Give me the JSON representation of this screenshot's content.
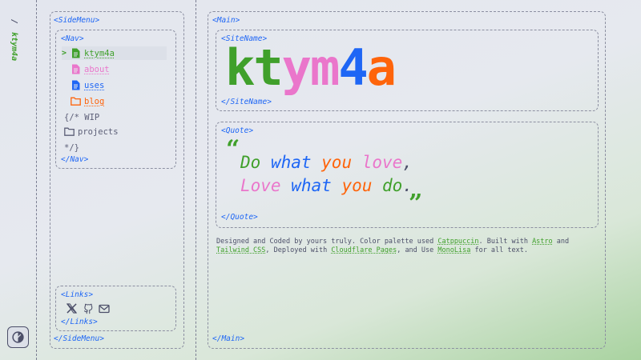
{
  "rail": {
    "separator": "/",
    "site": "ktym4a"
  },
  "tags": {
    "side_menu_open": "<SideMenu>",
    "side_menu_close": "</SideMenu>",
    "nav_open": "<Nav>",
    "nav_close": "</Nav>",
    "links_open": "<Links>",
    "links_close": "</Links>",
    "main_open": "<Main>",
    "main_close": "</Main>",
    "site_name_open": "<SiteName>",
    "site_name_close": "</SiteName>",
    "quote_open": "<Quote>",
    "quote_close": "</Quote>"
  },
  "nav": {
    "caret": ">",
    "items": [
      {
        "label": "ktym4a",
        "icon": "file-icon",
        "color": "#40a02b",
        "active": true
      },
      {
        "label": "about",
        "icon": "file-icon",
        "color": "#ea76cb",
        "active": false
      },
      {
        "label": "uses",
        "icon": "file-icon",
        "color": "#1e66f5",
        "active": false
      },
      {
        "label": "blog",
        "icon": "folder-icon",
        "color": "#fe640b",
        "active": false
      }
    ],
    "wip_open": "{/* WIP",
    "wip_item": "projects",
    "wip_close": "*/}"
  },
  "links": [
    {
      "name": "x-icon"
    },
    {
      "name": "github-icon"
    },
    {
      "name": "mail-icon"
    }
  ],
  "site_name": {
    "letters": [
      {
        "ch": "k",
        "color": "#40a02b"
      },
      {
        "ch": "t",
        "color": "#40a02b"
      },
      {
        "ch": "y",
        "color": "#ea76cb"
      },
      {
        "ch": "m",
        "color": "#ea76cb"
      },
      {
        "ch": "4",
        "color": "#1e66f5"
      },
      {
        "ch": "a",
        "color": "#fe640b"
      }
    ]
  },
  "quote": {
    "open_mark": "“",
    "close_mark": "”",
    "line1": [
      {
        "text": "Do",
        "color": "#40a02b"
      },
      {
        "text": " what",
        "color": "#1e66f5"
      },
      {
        "text": " you",
        "color": "#fe640b"
      },
      {
        "text": " love",
        "color": "#ea76cb"
      },
      {
        "text": ",",
        "color": "#4c4f69"
      }
    ],
    "line2": [
      {
        "text": "Love",
        "color": "#ea76cb"
      },
      {
        "text": " what",
        "color": "#1e66f5"
      },
      {
        "text": " you",
        "color": "#fe640b"
      },
      {
        "text": " do",
        "color": "#40a02b"
      },
      {
        "text": ".",
        "color": "#4c4f69"
      }
    ]
  },
  "footer": {
    "t1": "Designed and Coded by yours truly. Color palette used ",
    "l1": "Catppuccin",
    "t2": ". Built with ",
    "l2": "Astro",
    "t3": " and ",
    "l3": "Tailwind CSS",
    "t4": ", Deployed with ",
    "l4": "Cloudflare Pages",
    "t5": ", and Use ",
    "l5": "MonoLisa",
    "t6": " for all text."
  },
  "colors": {
    "green": "#40a02b",
    "pink": "#ea76cb",
    "blue": "#1e66f5",
    "orange": "#fe640b",
    "text": "#4c4f69"
  }
}
